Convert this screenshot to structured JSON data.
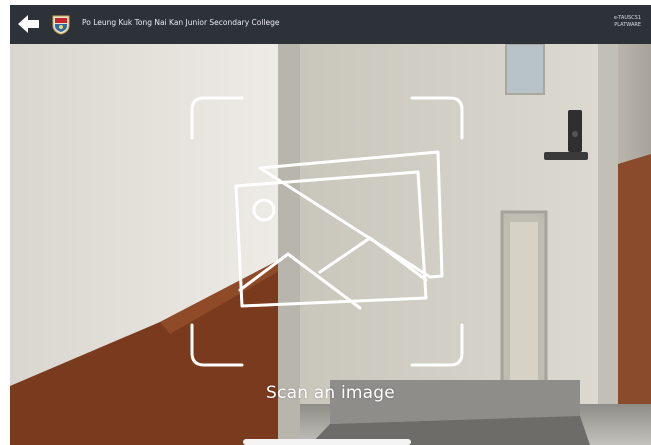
{
  "header": {
    "school_name": "Po Leung Kuk Tong Nai Kan Junior Secondary College",
    "brand_line1": "e-TAUSCS1",
    "brand_line2": "PLATWARE"
  },
  "scanner": {
    "prompt": "Scan an image"
  },
  "colors": {
    "topbar": "#2d3239",
    "overlay_stroke": "#ffffff",
    "door": "#d3d0c6",
    "wall": "#e6e3dc",
    "floor_brown": "#7a3a1e"
  },
  "icons": {
    "back": "arrow-left-icon",
    "crest": "school-crest-icon",
    "scan": "image-gallery-icon"
  }
}
